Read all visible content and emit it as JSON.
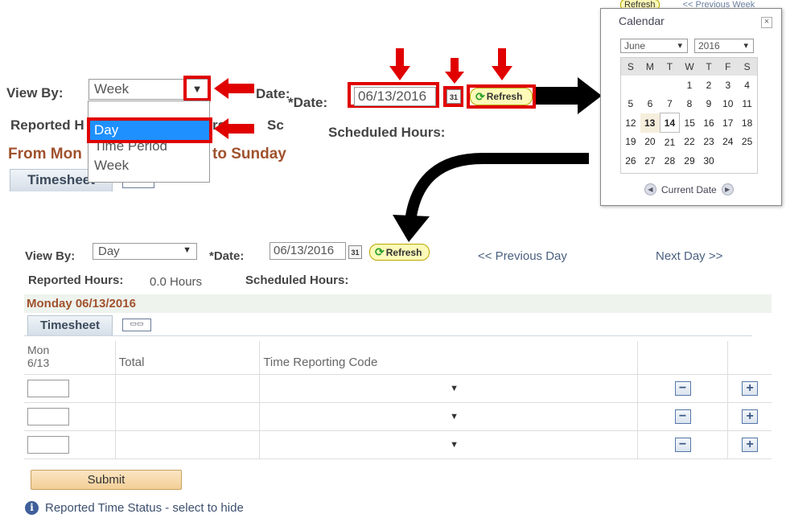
{
  "top": {
    "view_by_label": "View By:",
    "view_by_value": "Week",
    "date_label_hidden": "Date:",
    "dropdown_options": [
      "Day",
      "Time Period",
      "Week"
    ],
    "reported_label": "Reported H",
    "sc_fragment": "Sc",
    "rs_fragment": "rs",
    "from_text": "From Mon",
    "to_sunday": "to Sunday",
    "timesheet_tab": "Timesheet",
    "date_label": "*Date:",
    "date_value": "06/13/2016",
    "cal_icon_text": "31",
    "refresh_label": "Refresh",
    "scheduled_label": "Scheduled Hours:"
  },
  "calendar": {
    "title": "Calendar",
    "close": "×",
    "month": "June",
    "year": "2016",
    "weekdays": [
      "S",
      "M",
      "T",
      "W",
      "T",
      "F",
      "S"
    ],
    "weeks": [
      [
        "",
        "",
        "",
        "1",
        "2",
        "3",
        "4"
      ],
      [
        "5",
        "6",
        "7",
        "8",
        "9",
        "10",
        "11"
      ],
      [
        "12",
        "13",
        "14",
        "15",
        "16",
        "17",
        "18"
      ],
      [
        "19",
        "20",
        "21",
        "22",
        "23",
        "24",
        "25"
      ],
      [
        "26",
        "27",
        "28",
        "29",
        "30",
        "",
        ""
      ]
    ],
    "current_date": "Current Date",
    "bg_refresh": "Refresh",
    "bg_prev": "<< Previous Week"
  },
  "bottom": {
    "view_by_label": "View By:",
    "view_by_value": "Day",
    "date_label": "*Date:",
    "date_value": "06/13/2016",
    "cal_icon_text": "31",
    "refresh_label": "Refresh",
    "prev_day": "<< Previous Day",
    "next_day": "Next Day >>",
    "reported_label": "Reported Hours:",
    "reported_value": "0.0 Hours",
    "scheduled_label": "Scheduled Hours:",
    "day_title": "Monday 06/13/2016",
    "timesheet_tab": "Timesheet",
    "col_day": "Mon",
    "col_date": "6/13",
    "col_total": "Total",
    "col_trc": "Time Reporting Code",
    "minus": "−",
    "plus": "+",
    "submit": "Submit",
    "status": "Reported Time Status - select to hide"
  },
  "colors": {
    "highlight_red": "#e00000",
    "dropdown_selected": "#1e90ff",
    "title_brown": "#a0522d"
  }
}
